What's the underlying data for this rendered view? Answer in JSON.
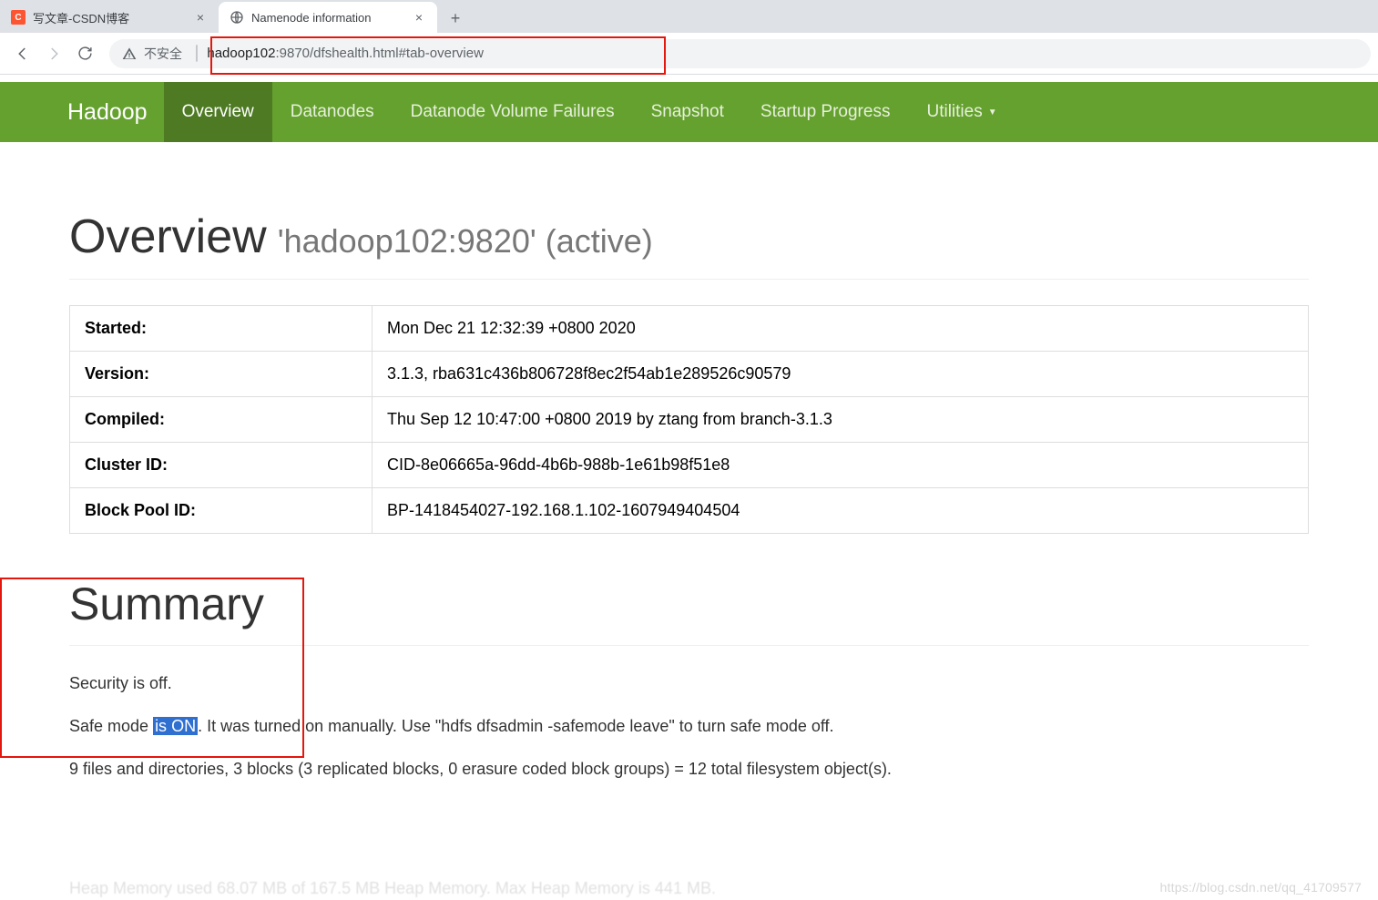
{
  "browser": {
    "tabs": [
      {
        "title": "写文章-CSDN博客",
        "favicon": "C",
        "active": false
      },
      {
        "title": "Namenode information",
        "favicon": "globe",
        "active": true
      }
    ],
    "url": {
      "insecure_label": "不安全",
      "host": "hadoop102",
      "port": ":9870",
      "path": "/dfshealth.html#tab-overview"
    }
  },
  "nav": {
    "brand": "Hadoop",
    "items": [
      {
        "label": "Overview",
        "active": true
      },
      {
        "label": "Datanodes"
      },
      {
        "label": "Datanode Volume Failures"
      },
      {
        "label": "Snapshot"
      },
      {
        "label": "Startup Progress"
      },
      {
        "label": "Utilities",
        "dropdown": true
      }
    ]
  },
  "overview": {
    "heading": "Overview",
    "sub": "'hadoop102:9820' (active)",
    "rows": {
      "started_k": "Started:",
      "started_v": "Mon Dec 21 12:32:39 +0800 2020",
      "version_k": "Version:",
      "version_v": "3.1.3, rba631c436b806728f8ec2f54ab1e289526c90579",
      "compiled_k": "Compiled:",
      "compiled_v": "Thu Sep 12 10:47:00 +0800 2019 by ztang from branch-3.1.3",
      "cluster_k": "Cluster ID:",
      "cluster_v": "CID-8e06665a-96dd-4b6b-988b-1e61b98f51e8",
      "bp_k": "Block Pool ID:",
      "bp_v": "BP-1418454027-192.168.1.102-1607949404504"
    }
  },
  "summary": {
    "heading": "Summary",
    "security": "Security is off.",
    "safemode_pre": "Safe mode ",
    "safemode_hl": "is ON",
    "safemode_post": ". It was turned on manually. Use \"hdfs dfsadmin -safemode leave\" to turn safe mode off.",
    "fsobjects": "9 files and directories, 3 blocks (3 replicated blocks, 0 erasure coded block groups) = 12 total filesystem object(s).",
    "heap_cut": "Heap Memory used 68.07 MB of 167.5 MB Heap Memory. Max Heap Memory is 441 MB."
  },
  "watermark": "https://blog.csdn.net/qq_41709577"
}
